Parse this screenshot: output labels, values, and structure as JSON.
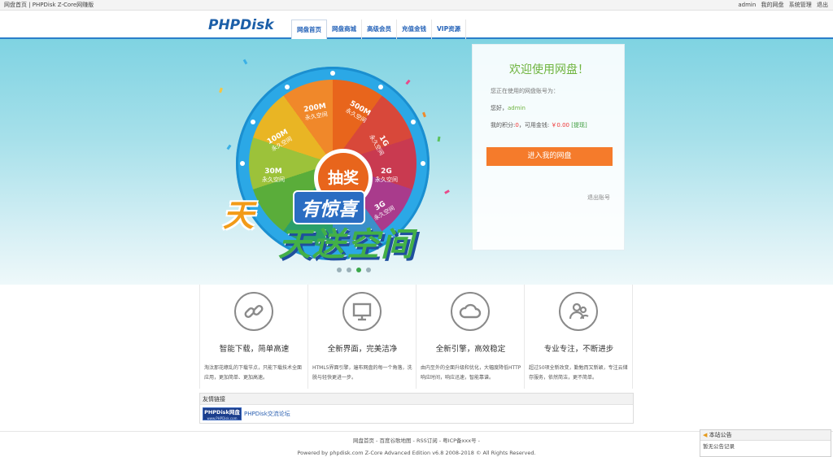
{
  "topbar": {
    "left_text": "网盘首页 | PHPDisk Z-Core网赚版",
    "user": "admin",
    "my_disk": "我的网盘",
    "admin": "系统管理",
    "logout": "退出"
  },
  "header": {
    "logo": "PHPDisk",
    "nav": [
      "网盘首页",
      "网盘商城",
      "高级会员",
      "充值金钱",
      "VIP资源"
    ]
  },
  "banner": {
    "wheel_center": "抽奖",
    "segments": [
      {
        "size": "500M",
        "unit": "永久空间"
      },
      {
        "size": "1G",
        "unit": "永久空间"
      },
      {
        "size": "2G",
        "unit": "永久空间"
      },
      {
        "size": "3G",
        "unit": "永久空间"
      },
      {
        "size": "30M",
        "unit": "永久空间"
      },
      {
        "size": "100M",
        "unit": "永久空间"
      },
      {
        "size": "200M",
        "unit": "永久空间"
      }
    ],
    "slogan_a": "天",
    "slogan_b": "有惊喜",
    "slogan_c": "天送空间"
  },
  "login_panel": {
    "title": "欢迎使用网盘！",
    "account_label": "您正在使用的网盘账号为：",
    "hello_prefix": "您好，",
    "username": "admin",
    "points_label": "我的积分:",
    "points": "0",
    "balance_label": "，可用金钱:",
    "balance": "￥0.00",
    "withdraw": "[提现]",
    "enter_button": "进入我的网盘",
    "logout": "退出账号"
  },
  "features": [
    {
      "icon": "link-icon",
      "title": "智能下载，简单高速",
      "desc": "淘汰那花缭乱的下载节点，只能下载技术全面应用，更加简单、更加高速。"
    },
    {
      "icon": "monitor-icon",
      "title": "全新界面，完美洁净",
      "desc": "HTML5界面引擎，遍布网盘的每一个角落，洗脱与轻快更进一步。"
    },
    {
      "icon": "cloud-icon",
      "title": "全新引擎，高效稳定",
      "desc": "由内至外的全面升级和优化，大幅度降低HTTP响应时间，响应迅速，智能靠谱。"
    },
    {
      "icon": "users-icon",
      "title": "专业专注，不断进步",
      "desc": "超过50项全新改变，勤勉而又新颖，专注云储存服务，依然简洁，更不简单。"
    }
  ],
  "links": {
    "header": "友情链接",
    "badge_top": "PHPDisk网盘",
    "badge_bottom": "www.PHPDisk.com",
    "text": "PHPDisk交流论坛"
  },
  "footer": {
    "line1": "网盘首页 - 百度谷歌地图 - RSS订阅 - 粤ICP备xxx号 -",
    "line2": "Powered by phpdisk.com Z-Core Advanced Edition v6.8 2008-2018 © All Rights Reserved."
  },
  "notice": {
    "header": "本站公告",
    "body": "暂无公告记录"
  },
  "colors": {
    "brand_blue": "#2a7fc9",
    "accent_orange": "#f57b2b",
    "green": "#6fb43f"
  }
}
